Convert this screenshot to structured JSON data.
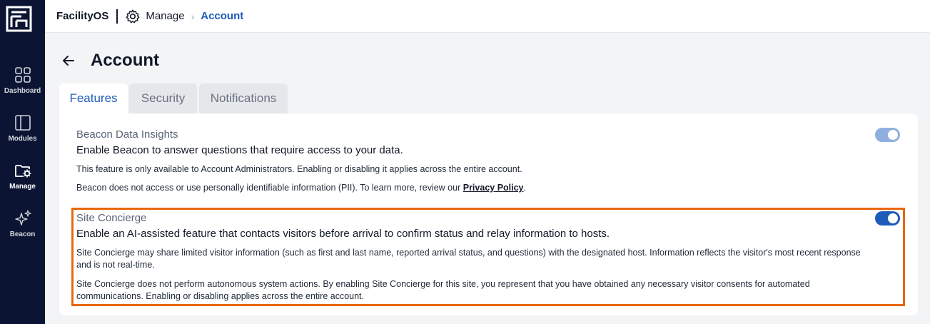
{
  "app": {
    "name": "FacilityOS"
  },
  "sidebar": {
    "items": [
      {
        "label": "Dashboard",
        "icon": "dashboard-grid-icon"
      },
      {
        "label": "Modules",
        "icon": "modules-panel-icon"
      },
      {
        "label": "Manage",
        "icon": "folder-gear-icon",
        "active": true
      },
      {
        "label": "Beacon",
        "icon": "sparkles-icon"
      }
    ]
  },
  "breadcrumb": {
    "section": "Manage",
    "current": "Account"
  },
  "page": {
    "title": "Account"
  },
  "tabs": [
    {
      "label": "Features",
      "active": true
    },
    {
      "label": "Security",
      "active": false
    },
    {
      "label": "Notifications",
      "active": false
    }
  ],
  "features": [
    {
      "title": "Beacon Data Insights",
      "description": "Enable Beacon to answer questions that require access to your data.",
      "notes": [
        "This feature is only available to Account Administrators. Enabling or disabling it applies across the entire account.",
        "Beacon does not access or use personally identifiable information (PII). To learn more, review our"
      ],
      "link_text": "Privacy Policy",
      "note_suffix": ".",
      "enabled": true,
      "disabled_control": true
    },
    {
      "title": "Site Concierge",
      "description": "Enable an AI-assisted feature that contacts visitors before arrival to confirm status and relay information to hosts.",
      "notes": [
        "Site Concierge may share limited visitor information (such as first and last name, reported arrival status, and questions) with the designated host. Information reflects the visitor's most recent response and is not real-time.",
        "Site Concierge does not perform autonomous system actions. By enabling Site Concierge for this site, you represent that you have obtained any necessary visitor consents for automated communications. Enabling or disabling applies across the entire account."
      ],
      "enabled": true,
      "highlighted": true
    }
  ],
  "colors": {
    "sidebar_bg": "#0b1533",
    "accent": "#1e5bb8",
    "toggle_on": "#1e5bb8",
    "toggle_disabled": "#8fb0de",
    "highlight": "#e8680c"
  }
}
